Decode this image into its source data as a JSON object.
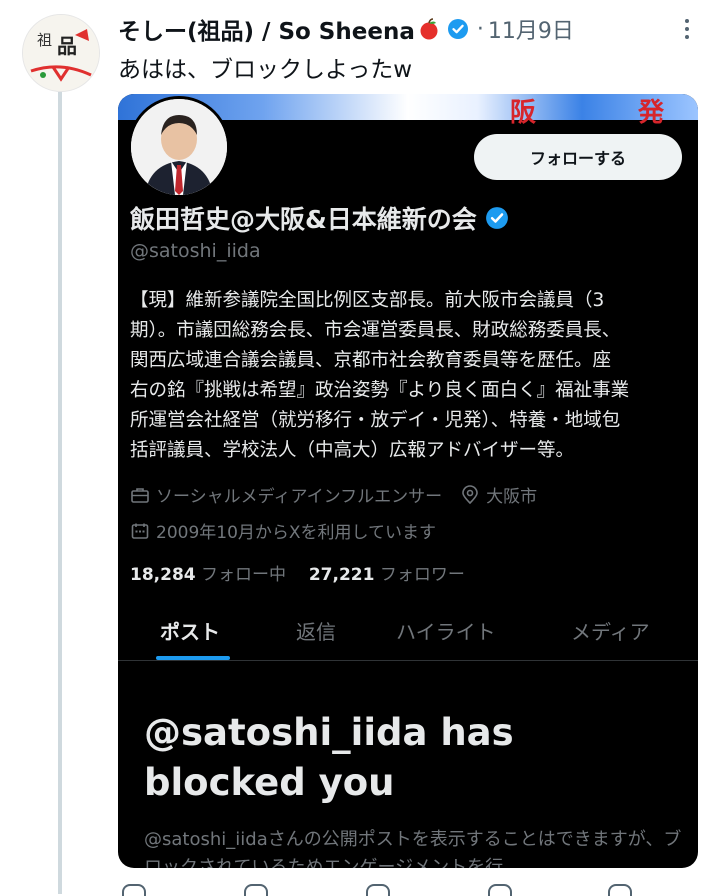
{
  "tweet": {
    "author_name": "そしー(祖品) / So Sheena",
    "separator": "·",
    "date": "11月9日",
    "text": "あはは、ブロックしよったw"
  },
  "embedded_profile": {
    "follow_button": "フォローする",
    "display_name": "飯田哲史@大阪&日本維新の会",
    "handle": "@satoshi_iida",
    "bio_lines": [
      "【現】維新参議院全国比例区支部長。前大阪市会議員（3",
      "期）。市議団総務会長、市会運営委員長、財政総務委員長、",
      "関西広域連合議会議員、京都市社会教育委員等を歴任。座",
      "右の銘『挑戦は希望』政治姿勢『より良く面白く』福祉事業",
      "所運営会社経営（就労移行・放デイ・児発）、特養・地域包",
      "括評議員、学校法人（中高大）広報アドバイザー等。"
    ],
    "category": "ソーシャルメディアインフルエンサー",
    "location": "大阪市",
    "joined": "2009年10月からXを利用しています",
    "following_count": "18,284",
    "following_label": "フォロー中",
    "followers_count": "27,221",
    "followers_label": "フォロワー",
    "tabs": [
      "ポスト",
      "返信",
      "ハイライト",
      "メディア"
    ],
    "active_tab": "ポスト",
    "blocked_title": "@satoshi_iida has blocked you",
    "blocked_desc": "@satoshi_iidaさんの公開ポストを表示することはできますが、ブロックされているためエンゲージメントを行"
  },
  "colors": {
    "accent_blue": "#1d9bf0",
    "verified_blue": "#1d9bf0",
    "dark_bg": "#000000",
    "muted_text": "#71767b"
  },
  "icons": [
    "apple-emoji-icon",
    "verified-badge-icon",
    "more-options-icon",
    "briefcase-icon",
    "location-pin-icon",
    "calendar-icon"
  ]
}
